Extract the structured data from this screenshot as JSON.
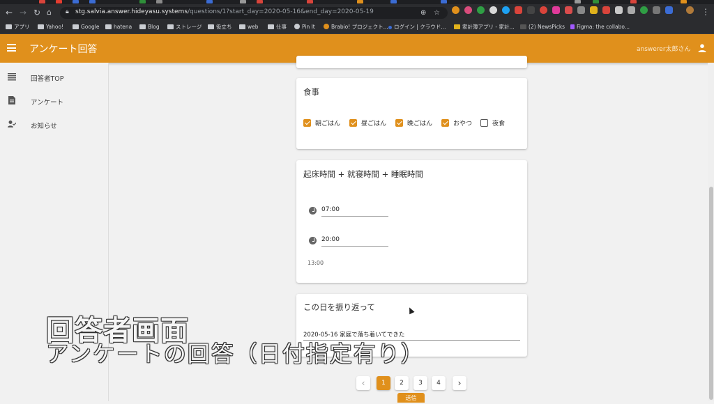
{
  "browser": {
    "url_host": "stg.salvia.answer.hideyasu.systems",
    "url_path": "/questions/1?start_day=2020-05-16&end_day=2020-05-19",
    "bookmarks": [
      {
        "label": "アプリ",
        "icon": "apps-grid-icon"
      },
      {
        "label": "Yahoo!",
        "icon": "folder-icon"
      },
      {
        "label": "Google",
        "icon": "folder-icon"
      },
      {
        "label": "hatena",
        "icon": "folder-icon"
      },
      {
        "label": "Blog",
        "icon": "folder-icon"
      },
      {
        "label": "ストレージ",
        "icon": "folder-icon"
      },
      {
        "label": "役立ち",
        "icon": "folder-icon"
      },
      {
        "label": "web",
        "icon": "folder-icon"
      },
      {
        "label": "仕事",
        "icon": "folder-icon"
      },
      {
        "label": "Pin It",
        "icon": "globe-icon"
      },
      {
        "label": "Brabio! プロジェクト...",
        "icon": "brabio-icon"
      },
      {
        "label": "ログイン | クラウド...",
        "icon": "star-icon"
      },
      {
        "label": "家計簿アプリ - 家計...",
        "icon": "wallet-icon"
      },
      {
        "label": "(2) NewsPicks",
        "icon": "newspicks-icon"
      },
      {
        "label": "Figma: the collabo...",
        "icon": "figma-icon"
      }
    ]
  },
  "app": {
    "title": "アンケート回答",
    "user_name": "answerer太郎さん",
    "accent": "#e0901c"
  },
  "sidebar": {
    "items": [
      {
        "label": "回答者TOP",
        "icon": "list-icon"
      },
      {
        "label": "アンケート",
        "icon": "document-icon"
      },
      {
        "label": "お知らせ",
        "icon": "person-check-icon"
      }
    ]
  },
  "questions": {
    "meal": {
      "title": "食事",
      "options": [
        {
          "label": "朝ごはん",
          "checked": true
        },
        {
          "label": "昼ごはん",
          "checked": true
        },
        {
          "label": "晩ごはん",
          "checked": true
        },
        {
          "label": "おやつ",
          "checked": true
        },
        {
          "label": "夜食",
          "checked": false
        }
      ]
    },
    "sleep": {
      "title": "起床時間 + 就寝時間 + 睡眠時間",
      "wake_time": "07:00",
      "bed_time": "20:00",
      "duration": "13:00"
    },
    "reflection": {
      "title": "この日を振り返って",
      "value": "2020-05-16 家庭で落ち着いてできた"
    }
  },
  "pagination": {
    "prev": "‹",
    "next": "›",
    "pages": [
      "1",
      "2",
      "3",
      "4"
    ],
    "current": "1"
  },
  "submit_label": "送信",
  "caption": {
    "line1": "回答者画面",
    "line2": "アンケートの回答（日付指定有り）"
  }
}
